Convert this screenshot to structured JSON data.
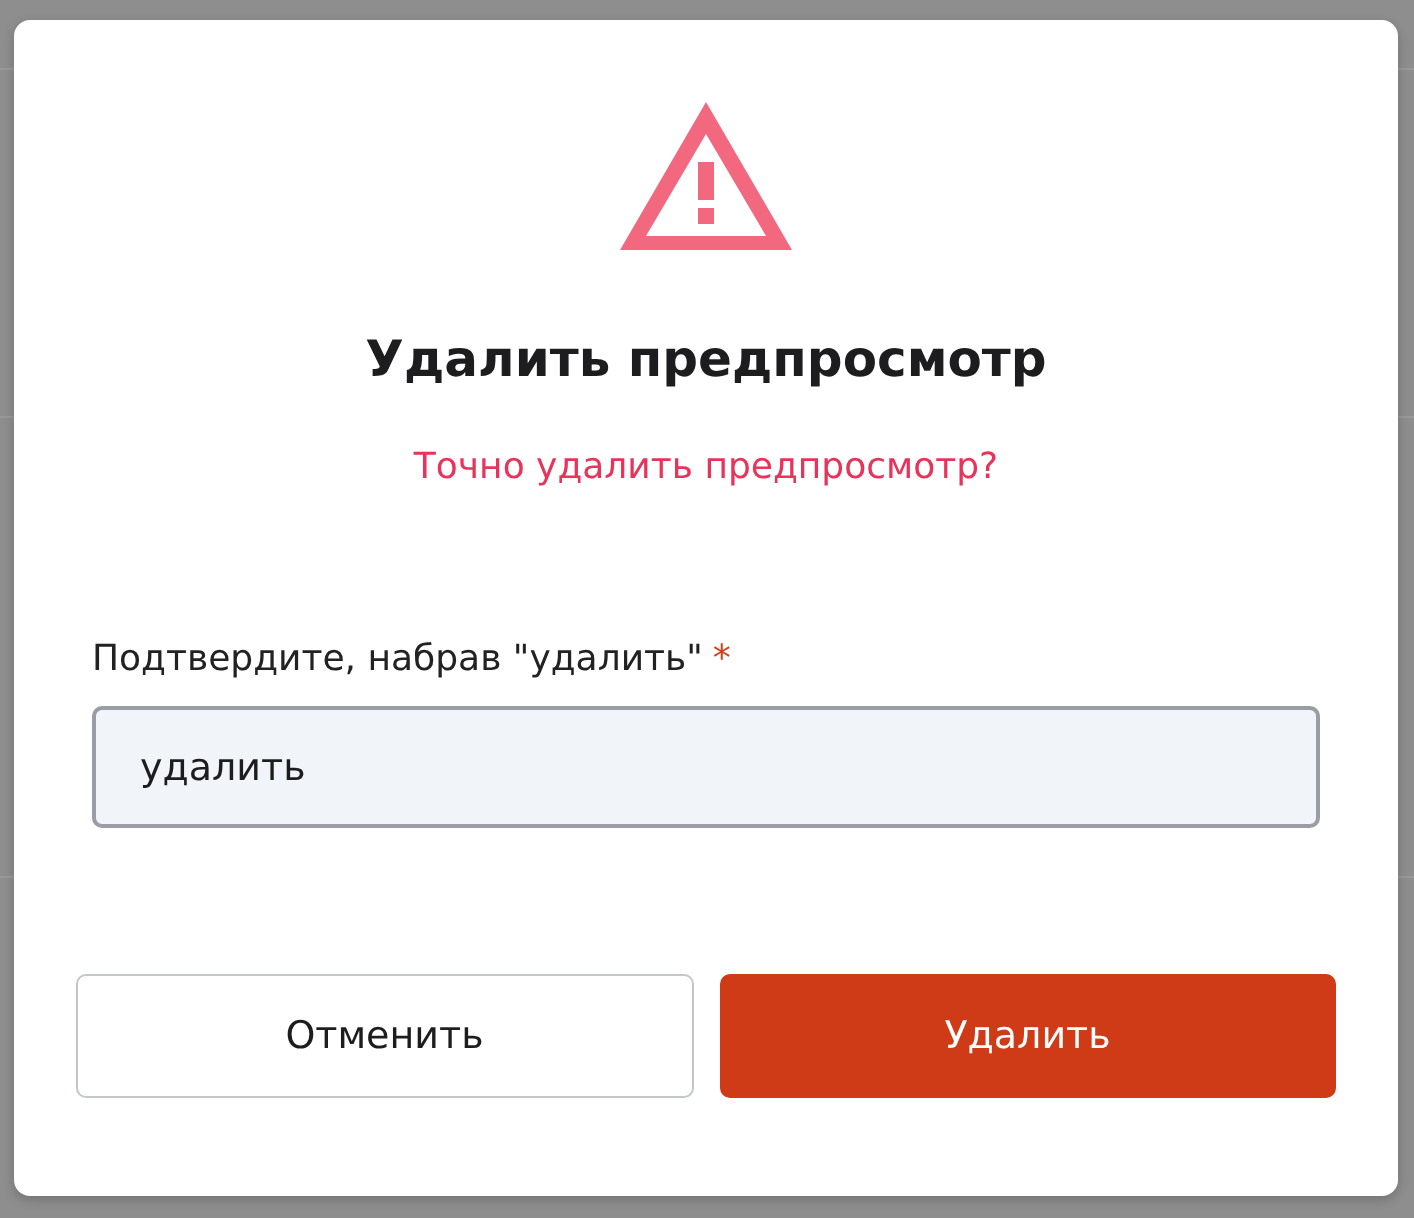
{
  "dialog": {
    "title": "Удалить предпросмотр",
    "message": "Точно удалить предпросмотр?",
    "field": {
      "label": "Подтвердите, набрав \"удалить\"",
      "required_mark": "*",
      "value": "удалить"
    },
    "buttons": [
      {
        "label": "Отменить",
        "kind": "secondary"
      },
      {
        "label": "Удалить",
        "kind": "danger"
      }
    ]
  }
}
